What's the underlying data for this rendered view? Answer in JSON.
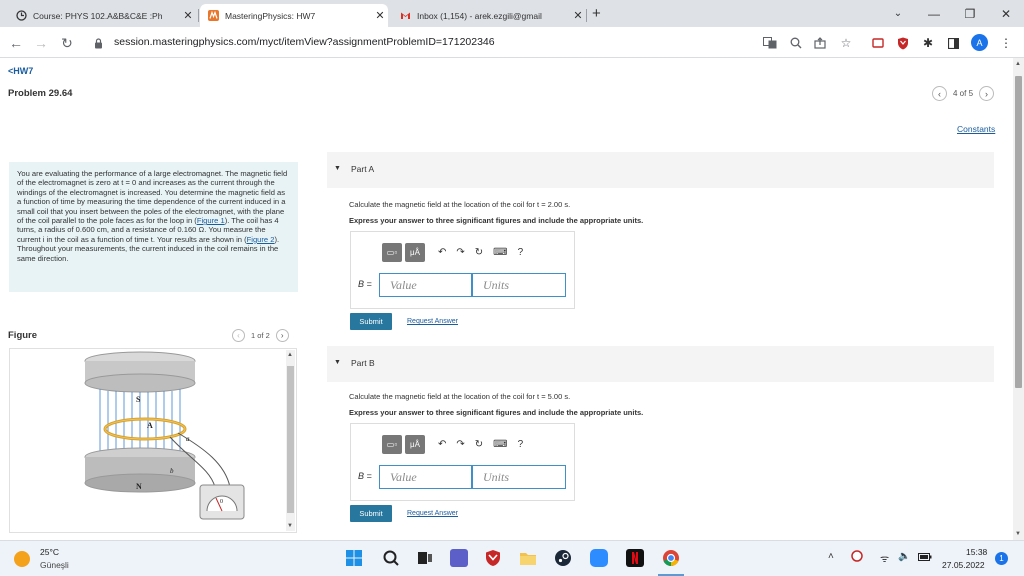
{
  "browser": {
    "tabs": [
      {
        "title": "Course: PHYS 102.A&B&C&E :Ph",
        "active": false
      },
      {
        "title": "MasteringPhysics: HW7",
        "active": true
      },
      {
        "title": "Inbox (1,154) - arek.ezgili@gmail",
        "active": false
      }
    ],
    "new_tab": "+",
    "url": "session.masteringphysics.com/myct/itemView?assignmentProblemID=171202346",
    "profile_initial": "A"
  },
  "page": {
    "back_link": "<HW7",
    "problem_title": "Problem 29.64",
    "pager": "4 of 5",
    "constants": "Constants",
    "intro": {
      "text_1": "You are evaluating the performance of a large electromagnet. The magnetic field of the electromagnet is zero at t = 0 and increases as the current through the windings of the electromagnet is increased. You determine the magnetic field as a function of time by measuring the time dependence of the current induced in a small coil that you insert between the poles of the electromagnet, with the plane of the coil parallel to the pole faces as for the loop in (",
      "link_1": "Figure 1",
      "text_2": "). The coil has 4 turns, a radius of 0.600 cm, and a resistance of 0.160 Ω. You measure the current i in the coil as a function of time t. Your results are shown in (",
      "link_2": "Figure 2",
      "text_3": "). Throughout your measurements, the current induced in the coil remains in the same direction."
    },
    "figure": {
      "label": "Figure",
      "pager": "1 of 2",
      "labels": {
        "s": "S",
        "n": "N",
        "a": "A",
        "a_small": "a",
        "b_small": "b",
        "meter": "0"
      }
    },
    "parts": [
      {
        "title": "Part A",
        "question": "Calculate the magnetic field at the location of the coil for t = 2.00 s.",
        "instruction": "Express your answer to three significant figures and include the appropriate units.",
        "var_label": "B =",
        "value_placeholder": "Value",
        "units_placeholder": "Units",
        "submit": "Submit",
        "request": "Request Answer"
      },
      {
        "title": "Part B",
        "question": "Calculate the magnetic field at the location of the coil for t = 5.00 s.",
        "instruction": "Express your answer to three significant figures and include the appropriate units.",
        "var_label": "B =",
        "value_placeholder": "Value",
        "units_placeholder": "Units",
        "submit": "Submit",
        "request": "Request Answer"
      }
    ],
    "toolbar_symbols": {
      "units": "μÅ",
      "help": "?"
    }
  },
  "taskbar": {
    "temperature": "25°C",
    "condition": "Güneşli",
    "time": "15:38",
    "date": "27.05.2022",
    "notifications": "1"
  },
  "colors": {
    "accent": "#27779e",
    "link": "#1a5c9e",
    "intro_bg": "#e8f3f6",
    "input_border": "#3f8fc9"
  }
}
